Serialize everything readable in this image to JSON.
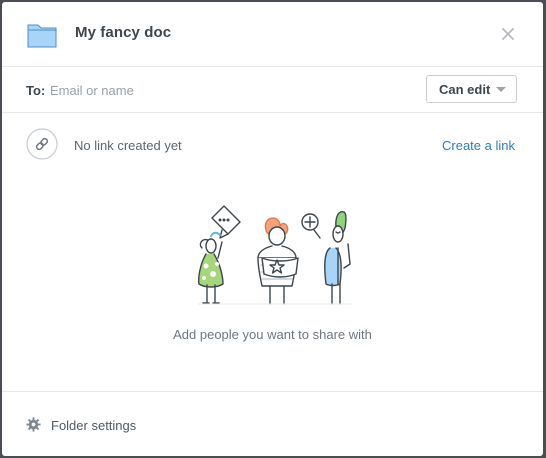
{
  "header": {
    "title": "My fancy doc",
    "folder_icon": "folder-icon",
    "close_icon": "close-icon"
  },
  "share": {
    "to_label": "To:",
    "input_placeholder": "Email or name",
    "input_value": "",
    "permission": {
      "selected": "Can edit",
      "caret_icon": "chevron-down-icon"
    }
  },
  "link": {
    "icon": "link-icon",
    "status": "No link created yet",
    "create_label": "Create a link"
  },
  "empty_state": {
    "illustration": "people-sharing-illustration",
    "message": "Add people you want to share with"
  },
  "footer": {
    "icon": "gear-icon",
    "label": "Folder settings"
  },
  "colors": {
    "accent": "#2a7fc0",
    "folder": "#a8d4f7",
    "text": "#3d464d",
    "muted": "#9aa1a8"
  }
}
